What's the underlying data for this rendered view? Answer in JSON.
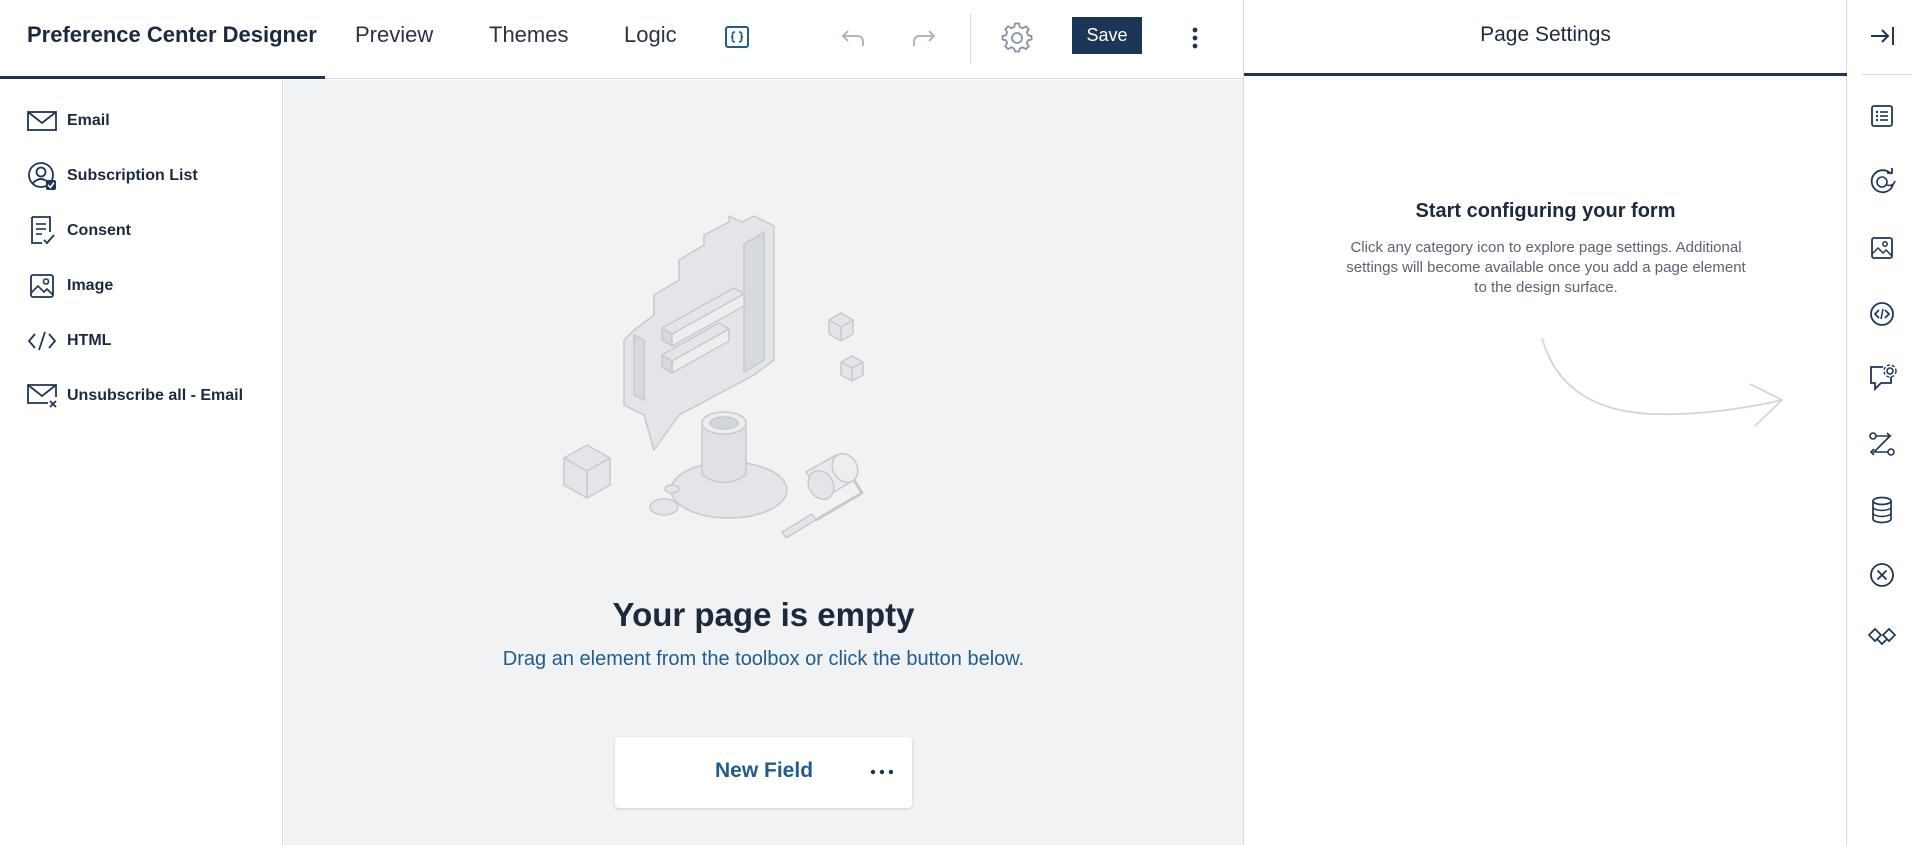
{
  "header": {
    "app_title": "Preference Center Designer",
    "tabs": [
      {
        "label": "Preview"
      },
      {
        "label": "Themes"
      },
      {
        "label": "Logic"
      }
    ],
    "code_icon": "braces-icon",
    "undo_icon": "undo-icon",
    "redo_icon": "redo-icon",
    "settings_icon": "gear-icon",
    "save_label": "Save",
    "more_icon": "vertical-ellipsis-icon"
  },
  "toolbox": {
    "items": [
      {
        "label": "Email",
        "icon": "envelope-icon"
      },
      {
        "label": "Subscription List",
        "icon": "subscription-list-icon"
      },
      {
        "label": "Consent",
        "icon": "consent-document-icon"
      },
      {
        "label": "Image",
        "icon": "image-icon"
      },
      {
        "label": "HTML",
        "icon": "code-icon"
      },
      {
        "label": "Unsubscribe all - Email",
        "icon": "envelope-x-icon"
      }
    ]
  },
  "canvas": {
    "empty_title": "Your page is empty",
    "empty_subtitle": "Drag an element from the toolbox or click the button below.",
    "new_field_label": "New Field",
    "new_field_more_icon": "horizontal-ellipsis-icon"
  },
  "settings": {
    "header": "Page Settings",
    "prompt_title": "Start configuring your form",
    "prompt_text": "Click any category icon to explore page settings. Additional settings will become available once you add a page element to the design surface."
  },
  "rail": {
    "icons": [
      "collapse-panel-icon",
      "list-icon",
      "theme-refresh-icon",
      "image-icon",
      "code-circle-icon",
      "chat-settings-icon",
      "workflow-icon",
      "database-icon",
      "close-circle-icon",
      "handshake-icon"
    ]
  },
  "colors": {
    "brand": "#1d3658",
    "link": "#1f5d8f",
    "canvas_bg": "#f1f2f4"
  }
}
